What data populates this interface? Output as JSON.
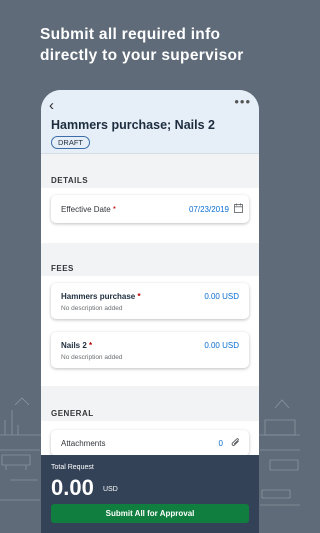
{
  "promo": {
    "headline": "Submit all required info directly to your supervisor"
  },
  "header": {
    "back_icon": "chevron-left-icon",
    "more_icon": "more-icon",
    "title": "Hammers purchase; Nails 2",
    "status": "DRAFT"
  },
  "details": {
    "section_label": "DETAILS",
    "effective_date_label": "Effective Date",
    "required_marker": "*",
    "effective_date_value": "07/23/2019",
    "calendar_icon": "calendar-icon"
  },
  "fees": {
    "section_label": "FEES",
    "items": [
      {
        "name": "Hammers purchase",
        "required_marker": "*",
        "amount": "0.00 USD",
        "description": "No description added"
      },
      {
        "name": "Nails 2",
        "required_marker": "*",
        "amount": "0.00 USD",
        "description": "No description added"
      }
    ]
  },
  "general": {
    "section_label": "GENERAL",
    "attachments_label": "Attachments",
    "attachments_count": "0",
    "attachment_icon": "paperclip-icon"
  },
  "footer": {
    "total_label": "Total Request",
    "total_amount": "0.00",
    "currency": "USD",
    "submit_label": "Submit All for Approval"
  },
  "colors": {
    "background": "#5f6b78",
    "header": "#e6eef8",
    "link": "#0a6ed1",
    "footer": "#334257",
    "submit": "#107e3e",
    "required": "#bb0000"
  }
}
